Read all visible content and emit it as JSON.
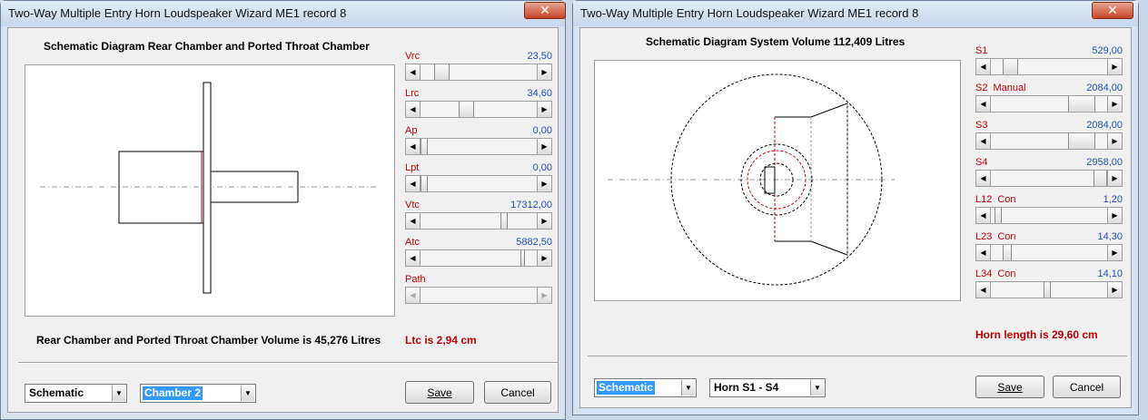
{
  "left_window": {
    "title": "Two-Way Multiple Entry Horn Loudspeaker Wizard   ME1 record 8",
    "close_label": "✕",
    "heading": "Schematic Diagram   Rear Chamber and Ported Throat Chamber",
    "controls": [
      {
        "label": "Vrc",
        "value": "23,50",
        "thumb": 0.12
      },
      {
        "label": "Lrc",
        "value": "34,60",
        "thumb": 0.39
      },
      {
        "label": "Ap",
        "value": "0,00",
        "thumb": 0.0
      },
      {
        "label": "Lpt",
        "value": "0,00",
        "thumb": 0.0
      },
      {
        "label": "Vtc",
        "value": "17312,00",
        "thumb": 0.76
      },
      {
        "label": "Atc",
        "value": "5882,50",
        "thumb": 0.9
      },
      {
        "label": "Path",
        "value": "",
        "thumb": null
      }
    ],
    "info": "Rear Chamber and Ported Throat Chamber Volume is 45,276 Litres",
    "info_red": "Ltc is 2,94 cm",
    "combo1": "Schematic",
    "combo2": "Chamber 2",
    "save_label": "Save",
    "cancel_label": "Cancel"
  },
  "right_window": {
    "title": "Two-Way Multiple Entry Horn Loudspeaker Wizard   ME1 record 8",
    "close_label": "✕",
    "heading": "Schematic Diagram   System Volume 112,409 Litres",
    "controls": [
      {
        "label": "S1",
        "sub": "",
        "value": "529,00",
        "thumb": 0.1,
        "color": "red"
      },
      {
        "label": "S2",
        "sub": "Manual",
        "value": "2084,00",
        "thumb": 0.68,
        "color": "red"
      },
      {
        "label": "S3",
        "sub": "",
        "value": "2084,00",
        "thumb": 0.68,
        "color": "red"
      },
      {
        "label": "S4",
        "sub": "",
        "value": "2958,00",
        "thumb": 0.99,
        "color": "red"
      },
      {
        "label": "L12",
        "sub": "Con",
        "value": "1,20",
        "thumb": 0.03,
        "color": "red"
      },
      {
        "label": "L23",
        "sub": "Con",
        "value": "14,30",
        "thumb": 0.14,
        "color": "red"
      },
      {
        "label": "L34",
        "sub": "Con",
        "value": "14,10",
        "thumb": 0.48,
        "color": "red"
      }
    ],
    "info_red": "Horn length is 29,60 cm",
    "combo1": "Schematic",
    "combo2": "Horn S1 - S4",
    "save_label": "Save",
    "cancel_label": "Cancel"
  }
}
